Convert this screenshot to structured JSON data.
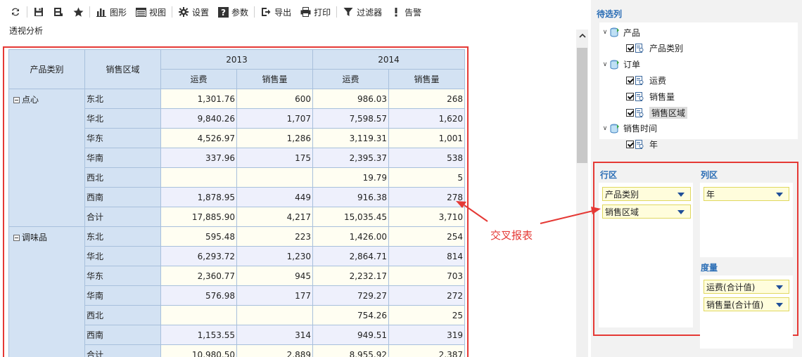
{
  "toolbar": {
    "items": [
      {
        "label": "",
        "icon": "refresh-icon"
      },
      {
        "label": "",
        "icon": "save-icon"
      },
      {
        "label": "",
        "icon": "save-as-icon"
      },
      {
        "label": "",
        "icon": "star-icon"
      },
      {
        "label": "图形",
        "icon": "chart-icon"
      },
      {
        "label": "视图",
        "icon": "view-icon"
      },
      {
        "label": "设置",
        "icon": "gear-icon"
      },
      {
        "label": "参数",
        "icon": "question-icon"
      },
      {
        "label": "导出",
        "icon": "export-icon"
      },
      {
        "label": "打印",
        "icon": "print-icon"
      },
      {
        "label": "过滤器",
        "icon": "filter-icon"
      },
      {
        "label": "告警",
        "icon": "alert-icon"
      }
    ]
  },
  "page_title": "透视分析",
  "grid": {
    "row_headers": [
      "产品类别",
      "销售区域"
    ],
    "years": [
      "2013",
      "2014"
    ],
    "measures": [
      "运费",
      "销售量",
      "运费",
      "销售量"
    ],
    "groups": [
      {
        "category": "点心",
        "rows": [
          {
            "region": "东北",
            "values": [
              "1,301.76",
              "600",
              "986.03",
              "268"
            ]
          },
          {
            "region": "华北",
            "values": [
              "9,840.26",
              "1,707",
              "7,598.57",
              "1,620"
            ]
          },
          {
            "region": "华东",
            "values": [
              "4,526.97",
              "1,286",
              "3,119.31",
              "1,001"
            ]
          },
          {
            "region": "华南",
            "values": [
              "337.96",
              "175",
              "2,395.37",
              "538"
            ]
          },
          {
            "region": "西北",
            "values": [
              "",
              "",
              "19.79",
              "5"
            ]
          },
          {
            "region": "西南",
            "values": [
              "1,878.95",
              "449",
              "916.38",
              "278"
            ]
          },
          {
            "region": "合计",
            "values": [
              "17,885.90",
              "4,217",
              "15,035.45",
              "3,710"
            ]
          }
        ]
      },
      {
        "category": "调味品",
        "rows": [
          {
            "region": "东北",
            "values": [
              "595.48",
              "223",
              "1,426.00",
              "254"
            ]
          },
          {
            "region": "华北",
            "values": [
              "6,293.72",
              "1,230",
              "2,864.71",
              "814"
            ]
          },
          {
            "region": "华东",
            "values": [
              "2,360.77",
              "945",
              "2,232.17",
              "703"
            ]
          },
          {
            "region": "华南",
            "values": [
              "576.98",
              "177",
              "729.27",
              "272"
            ]
          },
          {
            "region": "西北",
            "values": [
              "",
              "",
              "754.26",
              "25"
            ]
          },
          {
            "region": "西南",
            "values": [
              "1,153.55",
              "314",
              "949.51",
              "319"
            ]
          },
          {
            "region": "合计",
            "values": [
              "10,980.50",
              "2,889",
              "8,955.92",
              "2,387"
            ]
          }
        ]
      }
    ]
  },
  "side": {
    "title": "待选列",
    "tree": [
      {
        "label": "产品",
        "level": 0,
        "type": "table"
      },
      {
        "label": "产品类别",
        "level": 1,
        "type": "field",
        "checked": true
      },
      {
        "label": "订单",
        "level": 0,
        "type": "table"
      },
      {
        "label": "运费",
        "level": 1,
        "type": "field",
        "checked": true
      },
      {
        "label": "销售量",
        "level": 1,
        "type": "field",
        "checked": true
      },
      {
        "label": "销售区域",
        "level": 1,
        "type": "field",
        "checked": true,
        "selected": true
      },
      {
        "label": "销售时间",
        "level": 0,
        "type": "table"
      },
      {
        "label": "年",
        "level": 1,
        "type": "field",
        "checked": true
      }
    ],
    "row_zone": {
      "title": "行区",
      "items": [
        "产品类别",
        "销售区域"
      ]
    },
    "col_zone": {
      "title": "列区",
      "items": [
        "年"
      ]
    },
    "measure_zone": {
      "title": "度量",
      "items": [
        "运费(合计值)",
        "销售量(合计值)"
      ]
    }
  },
  "annotation": {
    "label": "交叉报表",
    "color": "#e53935"
  }
}
